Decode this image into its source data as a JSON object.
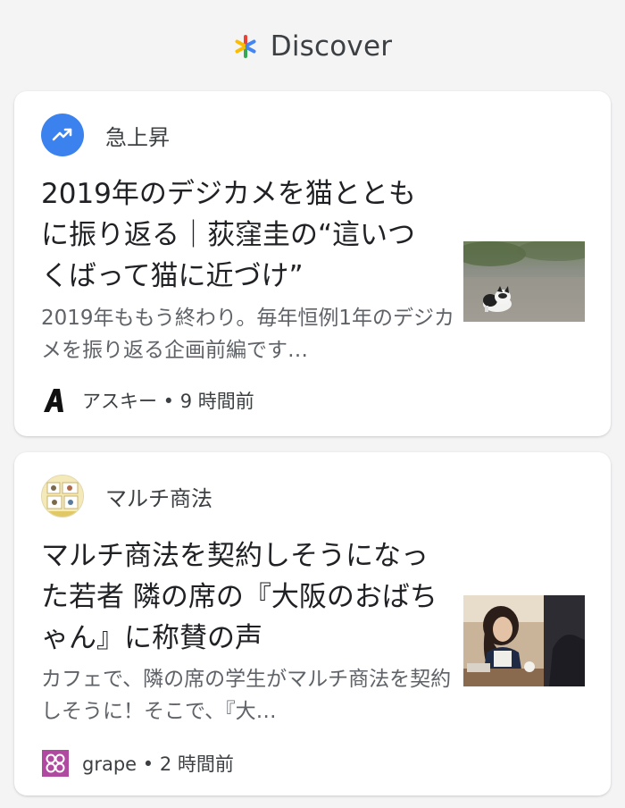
{
  "header": {
    "title": "Discover",
    "icon": "discover-asterisk-icon"
  },
  "cards": [
    {
      "topic": "急上昇",
      "topic_icon": "trending-up-icon",
      "title": "2019年のデジカメを猫とともに振り返る｜荻窪圭の“這いつくばって猫に近づけ”",
      "snippet": "2019年ももう終わり。毎年恒例1年のデジカメを振り返る企画前編です…",
      "source": "アスキー",
      "time": "9 時間前",
      "source_logo": "ascii-logo",
      "thumbnail": "cat-photo"
    },
    {
      "topic": "マルチ商法",
      "topic_icon": "manga-thumbnail-icon",
      "title": "マルチ商法を契約しそうになった若者 隣の席の『大阪のおばちゃん』に称賛の声",
      "snippet": "カフェで、隣の席の学生がマルチ商法を契約しそうに！そこで、『大…",
      "source": "grape",
      "time": "2 時間前",
      "source_logo": "grape-logo",
      "thumbnail": "cafe-women-photo"
    }
  ],
  "colors": {
    "background": "#f4f4f5",
    "card": "#ffffff",
    "trend_blue": "#3b82ee",
    "grape_purple": "#b04aa0",
    "secondary_text": "#5f6368"
  }
}
